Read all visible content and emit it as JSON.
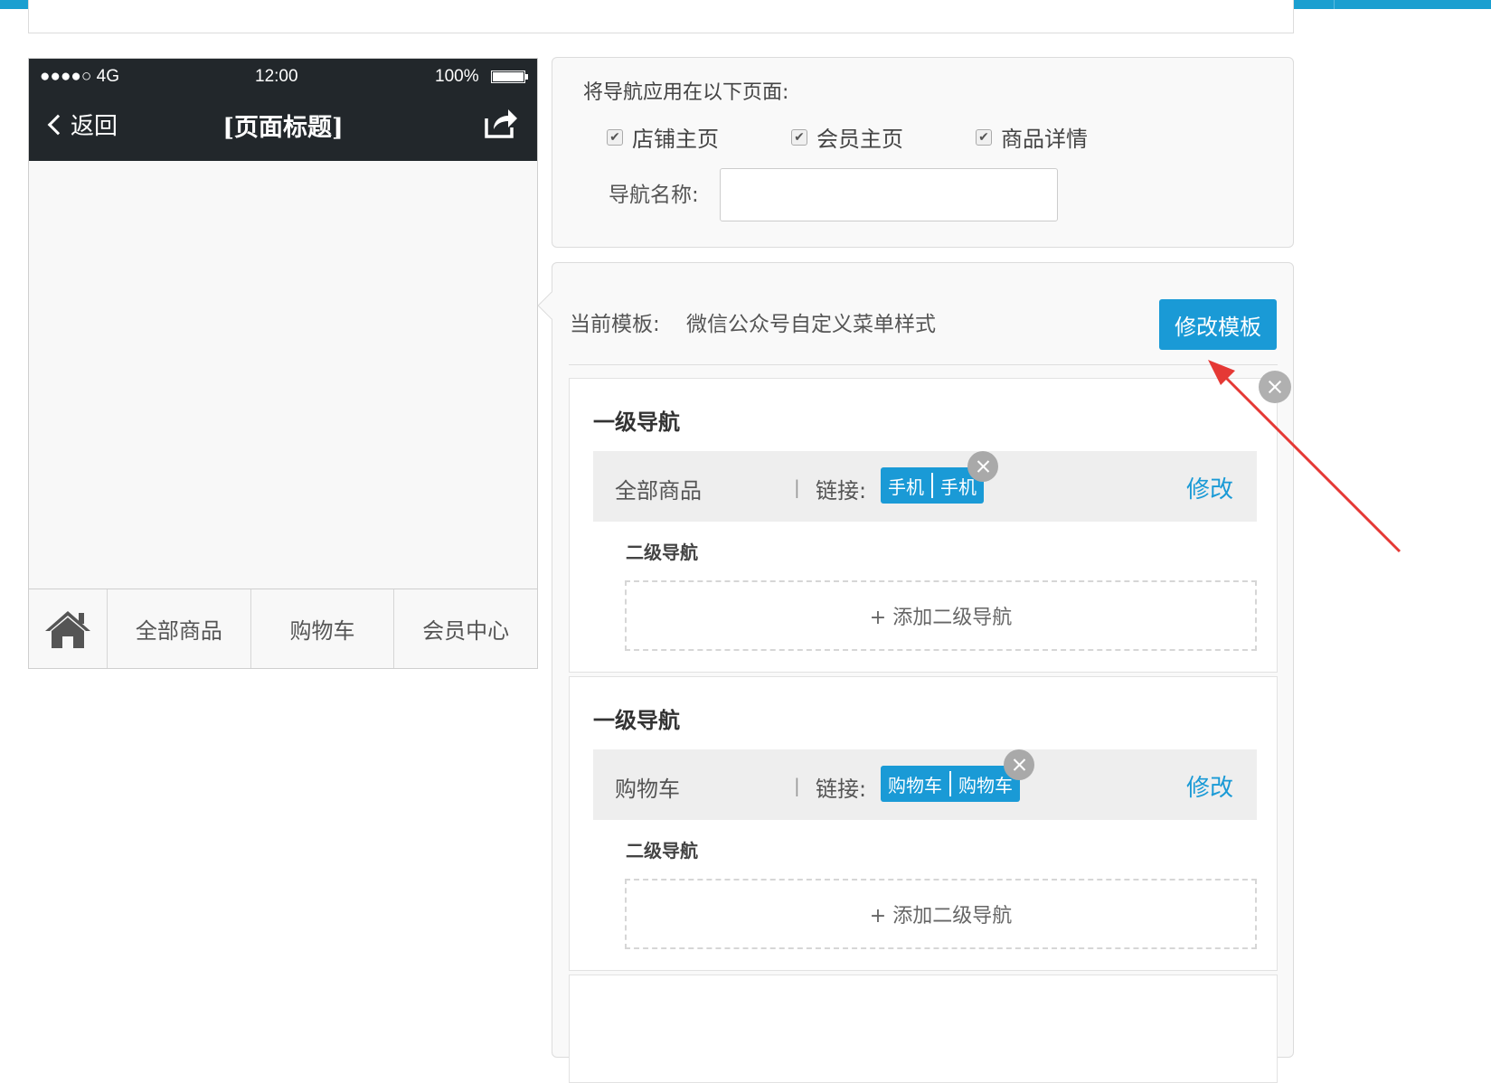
{
  "status_bar": {
    "carrier": "●●●●○ 4G",
    "time": "12:00",
    "battery_text": "100%",
    "battery_level": 1.0
  },
  "phone": {
    "back_label": "返回",
    "page_title": "[页面标题]",
    "tabs": [
      "全部商品",
      "购物车",
      "会员中心"
    ]
  },
  "apply": {
    "title": "将导航应用在以下页面:",
    "checkboxes": [
      {
        "label": "店铺主页",
        "checked": true
      },
      {
        "label": "会员主页",
        "checked": true
      },
      {
        "label": "商品详情",
        "checked": true
      }
    ],
    "name_label": "导航名称:",
    "name_value": ""
  },
  "template": {
    "label": "当前模板:",
    "name": "微信公众号自定义菜单样式",
    "edit_button": "修改模板"
  },
  "nav_cards": [
    {
      "title": "一级导航",
      "item_name": "全部商品",
      "separator": "|",
      "link_label": "链接:",
      "link_tag": [
        "手机",
        "手机"
      ],
      "edit_label": "修改",
      "sub_title": "二级导航",
      "add_sub": "+ 添加二级导航"
    },
    {
      "title": "一级导航",
      "item_name": "购物车",
      "separator": "|",
      "link_label": "链接:",
      "link_tag": [
        "购物车",
        "购物车"
      ],
      "edit_label": "修改",
      "sub_title": "二级导航",
      "add_sub": "+ 添加二级导航"
    }
  ],
  "colors": {
    "accent": "#1a9ad6",
    "topbar": "#1b9fd0",
    "phone_header": "#22272b",
    "annotation_arrow": "#e53935"
  }
}
